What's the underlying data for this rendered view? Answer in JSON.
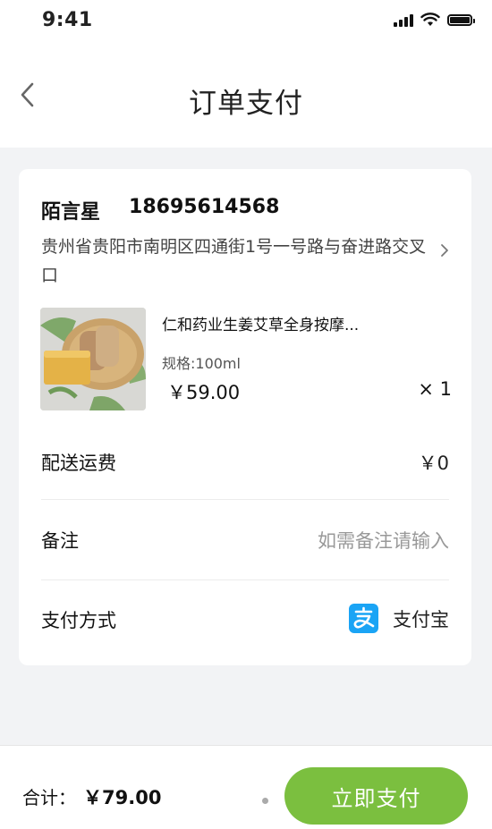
{
  "status_bar": {
    "time": "9:41"
  },
  "nav": {
    "title": "订单支付",
    "back_icon": "chevron-left-icon"
  },
  "address": {
    "name": "陌言星",
    "phone": "18695614568",
    "detail": "贵州省贵阳市南明区四通街1号一号路与奋进路交叉口"
  },
  "product": {
    "name": "仁和药业生姜艾草全身按摩...",
    "spec": "规格:100ml",
    "price": "￥59.00",
    "quantity": "× 1"
  },
  "shipping": {
    "label": "配送运费",
    "value": "￥0"
  },
  "remark": {
    "label": "备注",
    "placeholder": "如需备注请输入"
  },
  "payment": {
    "label": "支付方式",
    "method": "支付宝",
    "method_icon": "alipay-icon"
  },
  "footer": {
    "total_label": "合计：",
    "total_amount": "￥79.00",
    "pay_button": "立即支付"
  },
  "colors": {
    "accent": "#7bbf3f",
    "alipay": "#1aa4f5",
    "background": "#f2f3f5"
  }
}
